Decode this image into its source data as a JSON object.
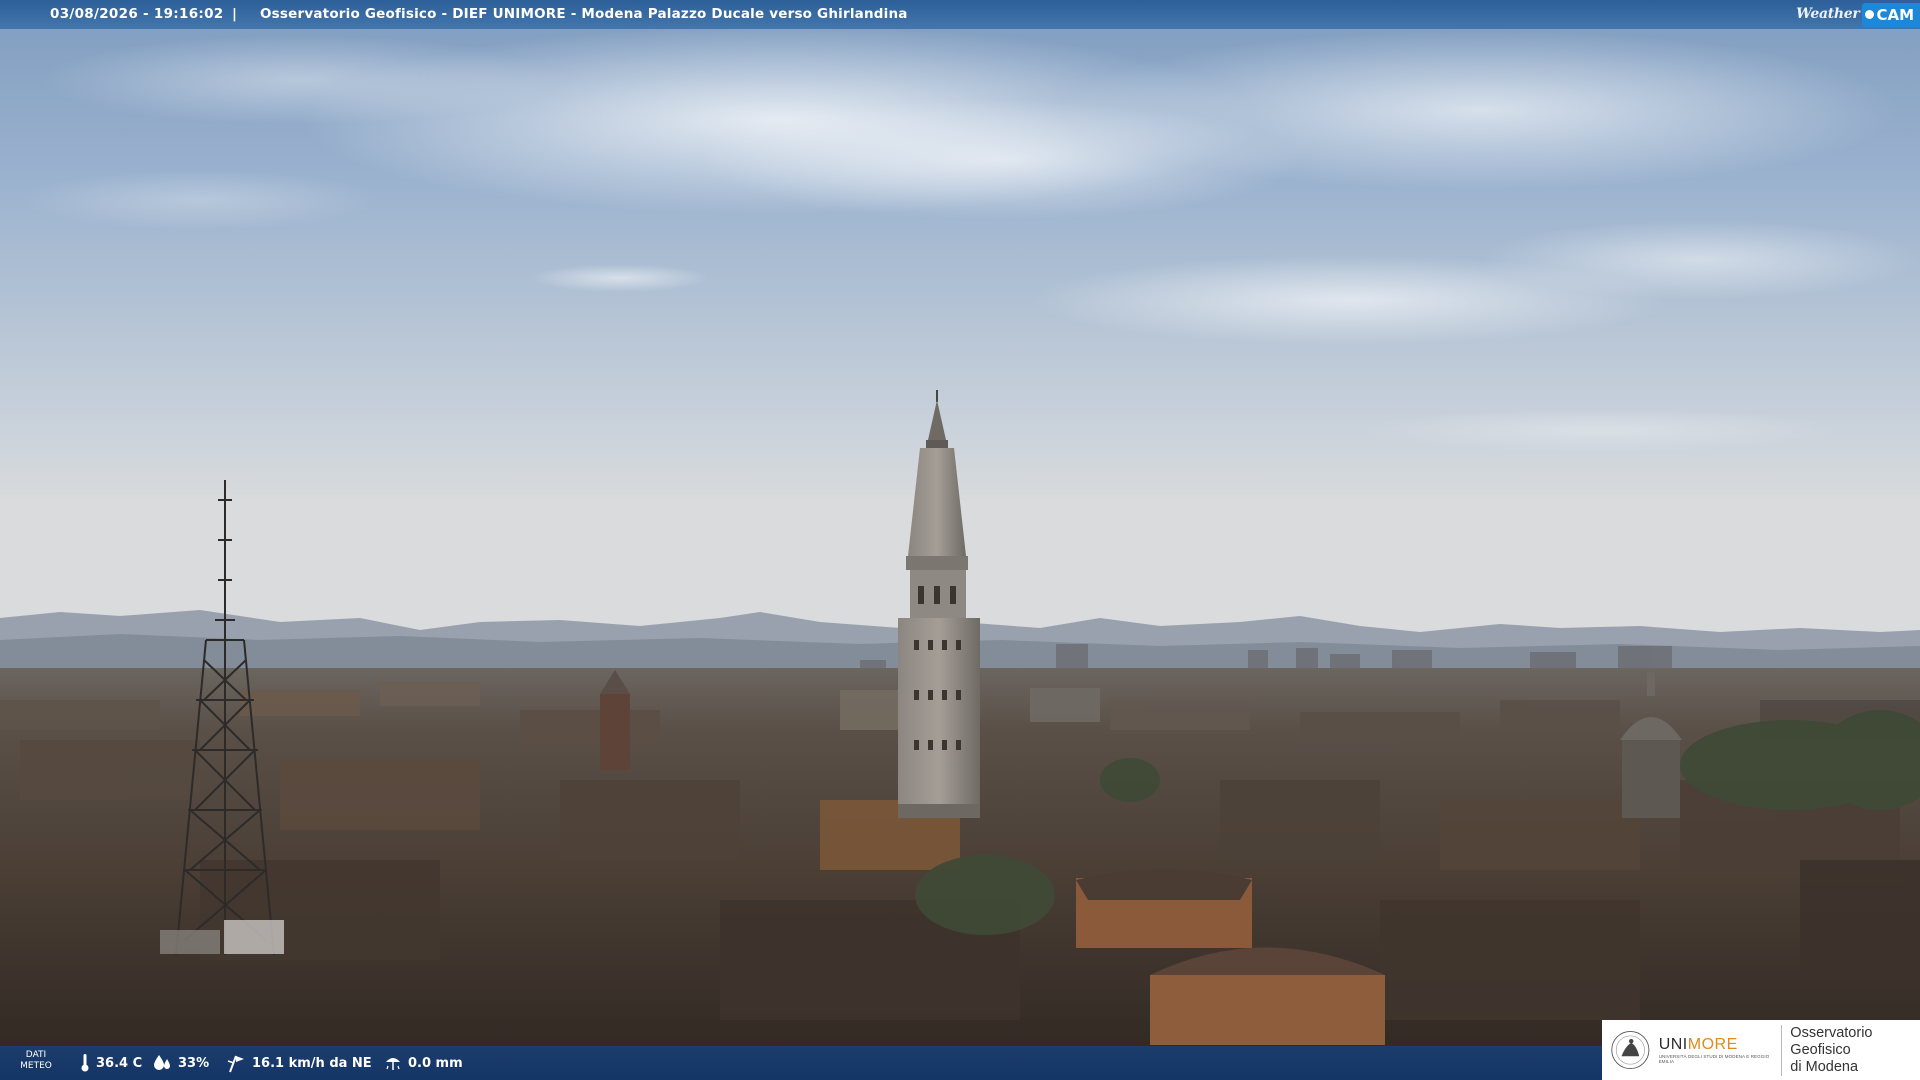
{
  "camera": {
    "timestamp": "03/08/2026 - 19:16:02",
    "separator": "|",
    "title": "Osservatorio Geofisico - DIEF UNIMORE - Modena Palazzo Ducale verso Ghirlandina",
    "brand_word": "Weather",
    "brand_cam": "CAM"
  },
  "weather": {
    "label": "DATI METEO",
    "temperature": "36.4 C",
    "humidity": "33%",
    "wind": "16.1 km/h da NE",
    "rain": "0.0 mm",
    "icons": [
      "thermometer-icon",
      "humidity-icon",
      "wind-icon",
      "rain-gauge-icon"
    ]
  },
  "logo": {
    "uni_prefix": "UNI",
    "uni_suffix": "MORE",
    "uni_subtitle": "UNIVERSITÀ DEGLI STUDI DI MODENA E REGGIO EMILIA",
    "obs_line1": "Osservatorio Geofisico",
    "obs_line2": "di Modena"
  },
  "colors": {
    "bar_blue": "#2f6aa8",
    "brand_accent": "#1e88d8",
    "unimore_orange": "#e08a1a"
  }
}
